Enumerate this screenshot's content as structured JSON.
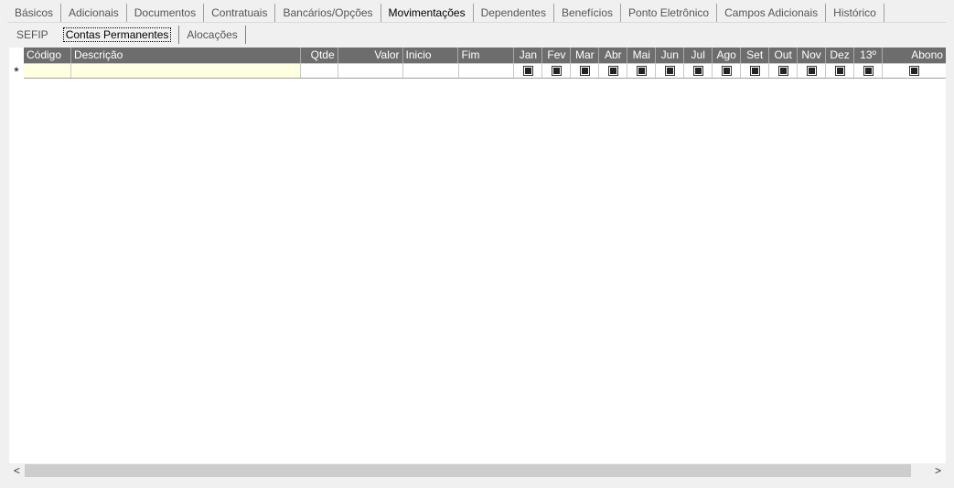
{
  "tabs": [
    "Básicos",
    "Adicionais",
    "Documentos",
    "Contratuais",
    "Bancários/Opções",
    "Movimentações",
    "Dependentes",
    "Benefícios",
    "Ponto Eletrônico",
    "Campos Adicionais",
    "Histórico"
  ],
  "subtabs": [
    "SEFIP",
    "Contas Permanentes",
    "Alocações"
  ],
  "grid": {
    "columns": [
      "Código",
      "Descrição",
      "Qtde",
      "Valor",
      "Inicio",
      "Fim",
      "Jan",
      "Fev",
      "Mar",
      "Abr",
      "Mai",
      "Jun",
      "Jul",
      "Ago",
      "Set",
      "Out",
      "Nov",
      "Dez",
      "13º",
      "Abono"
    ],
    "new_row_marker": "*"
  },
  "scrollbar": {
    "left_arrow": "<",
    "right_arrow": ">"
  }
}
